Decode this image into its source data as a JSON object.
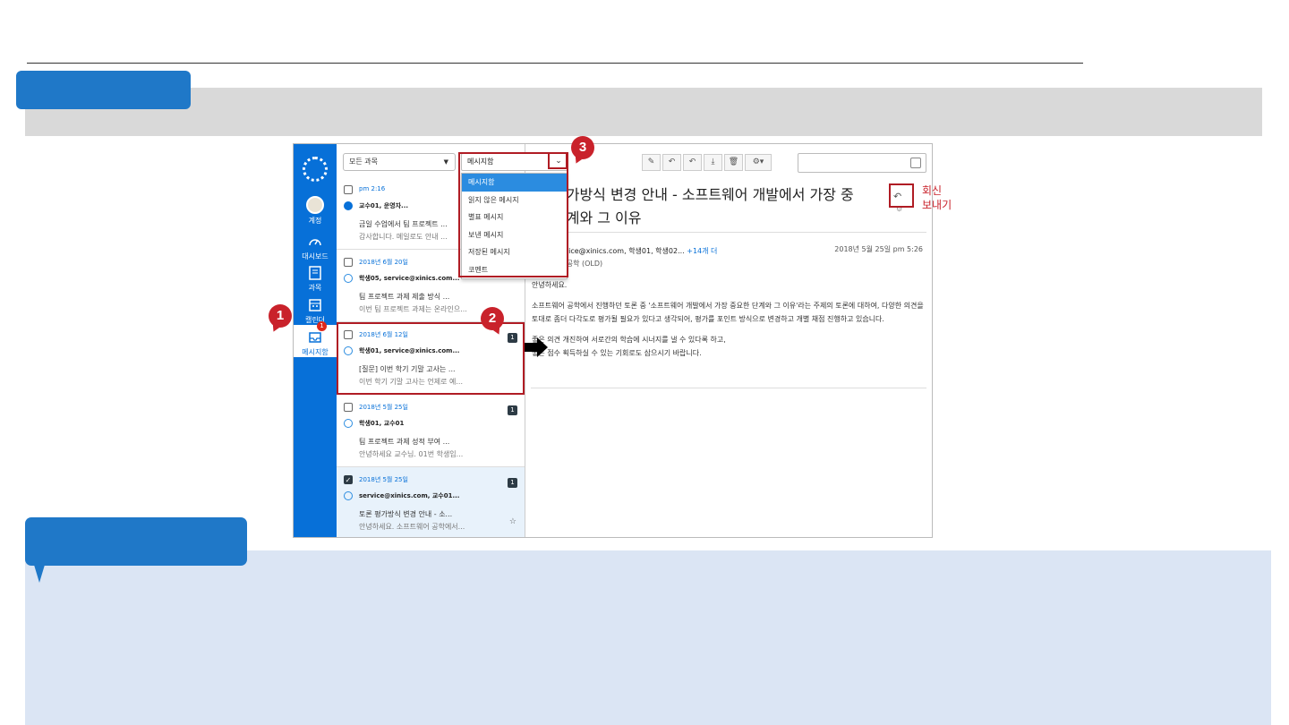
{
  "nav": {
    "account": "계정",
    "dashboard": "대시보드",
    "courses": "과목",
    "calendar": "캘린더",
    "inbox": "메시지함",
    "inbox_badge": "1"
  },
  "list": {
    "course_filter": "모든 과목",
    "messages": [
      {
        "date": "pm 2:16",
        "from": "교수01, 운영자...",
        "subject": "금일 수업에서 팀 프로젝트 ...",
        "preview": "감사합니다. 메일로도 안내 ...",
        "count": "",
        "read": false,
        "checked": false
      },
      {
        "date": "2018년 6월 20일",
        "from": "학생05, service@xinics.com...",
        "subject": "팀 프로젝트 과제 제출 방식 ...",
        "preview": "이번 팀 프로젝트 과제는 온라인으...",
        "count": "",
        "read": true,
        "checked": false
      },
      {
        "date": "2018년 6월 12일",
        "from": "학생01, service@xinics.com...",
        "subject": "[질문] 이번 학기 기말 고사는 ...",
        "preview": "이번 학기 기말 고사는 언제로 예...",
        "count": "1",
        "read": true,
        "checked": false
      },
      {
        "date": "2018년 5월 25일",
        "from": "학생01, 교수01",
        "subject": "팀 프로젝트 과제 성적 부여 ...",
        "preview": "안녕하세요 교수님. 01번 학생입...",
        "count": "1",
        "read": true,
        "checked": false
      },
      {
        "date": "2018년 5월 25일",
        "from": "service@xinics.com, 교수01...",
        "subject": "토론 평가방식 변경 안내 - 소...",
        "preview": "안녕하세요. 소프트웨어 공학에서...",
        "count": "1",
        "read": true,
        "checked": true
      }
    ]
  },
  "mailbox": {
    "selected": "메시지함",
    "options": [
      "메시지함",
      "읽지 않은 메시지",
      "별표 메시지",
      "보낸 메시지",
      "저장된 메시지",
      "코멘트"
    ]
  },
  "reader": {
    "title": "평가방식 변경 안내 - 소프트웨어 개발에서 가장 중요한 단계와 그 이유",
    "title_line1": "평가방식 변경 안내 - 소프트웨어 개발에서 가장 중",
    "title_line2": "단계와 그 이유",
    "from": "service@xinics.com, 학생01, 학생02...",
    "more": "+14개 더",
    "course": "퓨터공학 (OLD)",
    "date": "2018년 5월 25일 pm 5:26",
    "greeting": "안녕하세요.",
    "para1": "소프트웨어 공학에서 진행하던 토론 중 '소프트웨어 개발에서 가장 중요한 단계와 그 이유'라는 주제의 토론에 대하여, 다양한 의견을 토대로 좀더 다각도로 평가될 필요가 있다고 생각되어, 평가를 포인트 방식으로 변경하고 개별 채점 진행하고 있습니다.",
    "para2a": "좋은 의견 개진하여 서로간의 학습에 시너지를 낼 수 있다록 하고,",
    "para2b": "좋은 점수 획득하실 수 있는 기회로도 삼으시기 바랍니다."
  },
  "annotations": {
    "c1": "1",
    "c2": "2",
    "c3": "3",
    "reply_label": "회신",
    "send_label": "보내기"
  },
  "colors": {
    "nav_blue": "#0770d8",
    "annotation_red": "#c9222b",
    "header_blue": "#1f78c8",
    "panel_blue": "#dbe5f4"
  }
}
